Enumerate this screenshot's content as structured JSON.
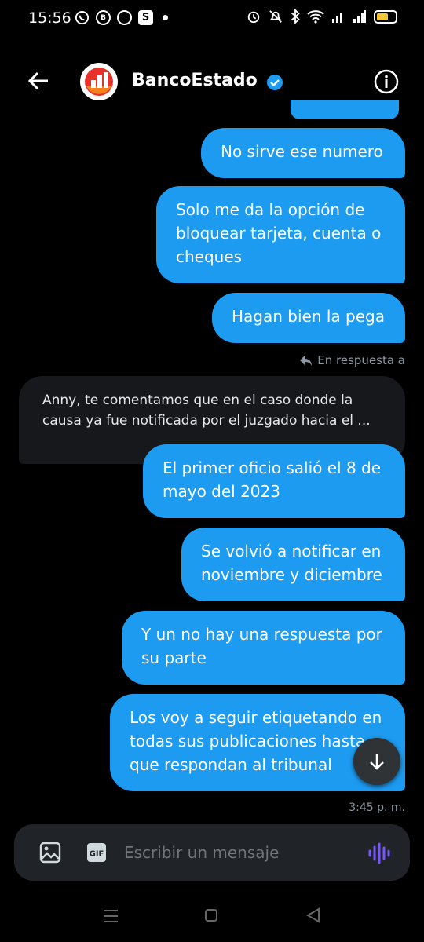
{
  "status_bar": {
    "time": "15:56",
    "b_label": "B",
    "s_label": "S"
  },
  "header": {
    "title": "BancoEstado",
    "verified": true
  },
  "messages_out": [
    "No sirve ese numero",
    "Solo me da la opción de\nbloquear tarjeta, cuenta o\ncheques",
    "Hagan bien la pega",
    "El primer oficio salió el 8 de\nmayo del 2023",
    "Se volvió a notificar en\nnoviembre y diciembre",
    "Y un no hay una respuesta por\nsu parte",
    "Los voy a seguir etiquetando en\ntodas sus publicaciones hasta\nque respondan al tribunal"
  ],
  "reply_label": "En respuesta a",
  "message_in": "Anny, te comentamos que en el caso donde la\ncausa ya fue notificada por el juzgado hacia el ...",
  "timestamp": "3:45 p. m.",
  "composer": {
    "placeholder": "Escribir un mensaje",
    "gif_label": "GIF"
  },
  "colors": {
    "accent": "#1d9bf0",
    "voice": "#7856ff",
    "battery": "#f3c637"
  }
}
